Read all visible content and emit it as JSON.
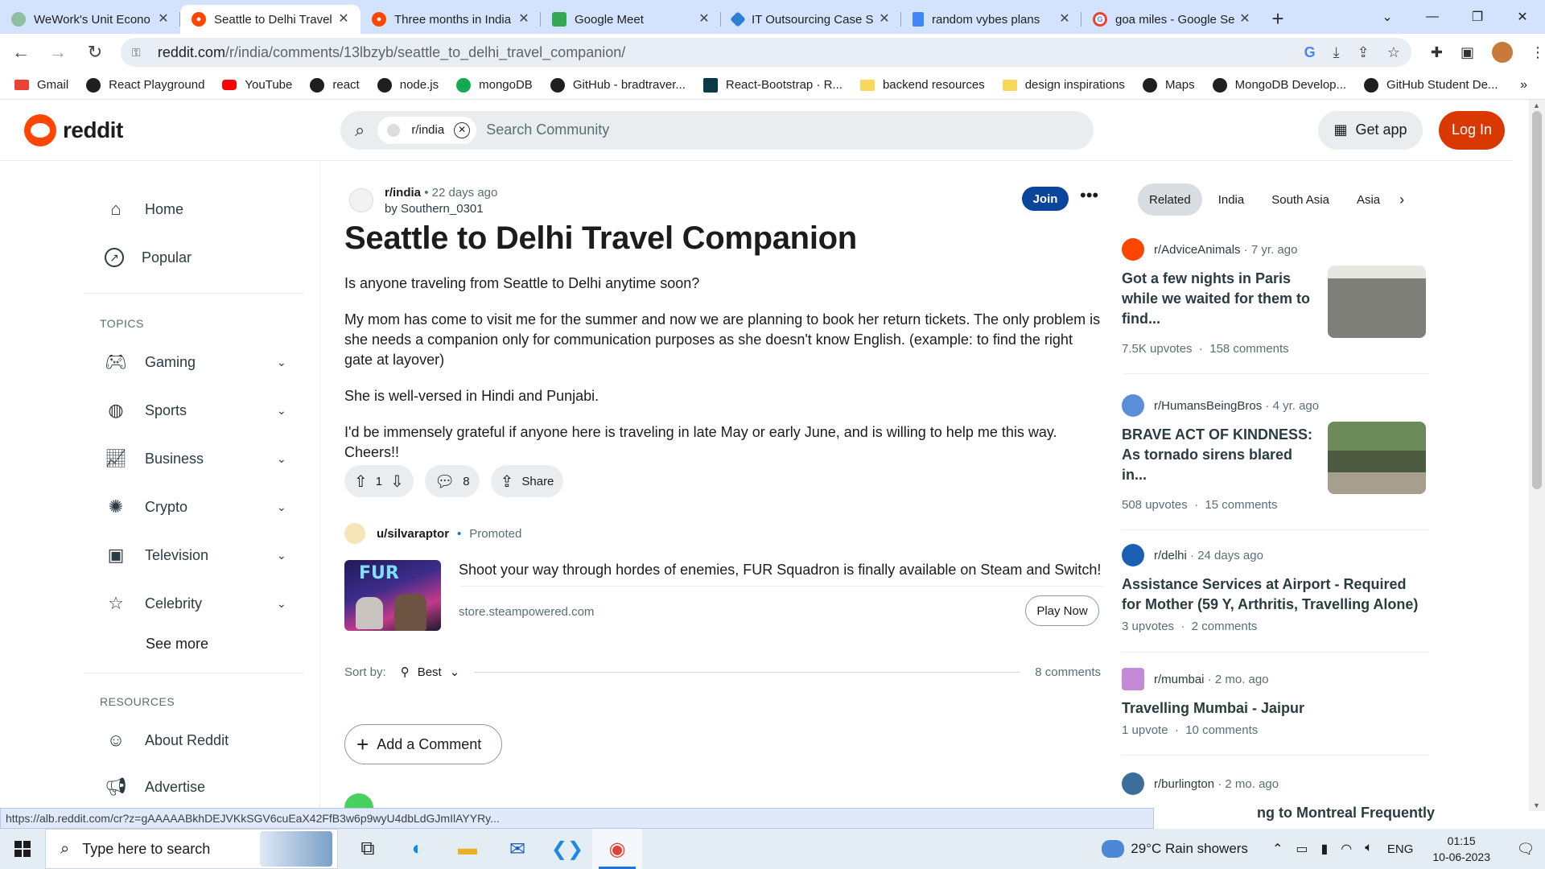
{
  "browser": {
    "tabs": [
      {
        "title": "WeWork's Unit Econo",
        "icon_color": "#8fbf9f",
        "active": false
      },
      {
        "title": "Seattle to Delhi Travel",
        "icon_color": "#ff4500",
        "active": true
      },
      {
        "title": "Three months in India",
        "icon_color": "#ff4500",
        "active": false
      },
      {
        "title": "Google Meet",
        "icon_color": "#34a853",
        "active": false
      },
      {
        "title": "IT Outsourcing Case S",
        "icon_color": "#2d7fd3",
        "active": false
      },
      {
        "title": "random vybes plans",
        "icon_color": "#4285f4",
        "active": false
      },
      {
        "title": "goa miles - Google Se",
        "icon_color": "#ea4335",
        "active": false
      }
    ],
    "url_host": "reddit.com",
    "url_path": "/r/india/comments/13lbzyb/seattle_to_delhi_travel_companion/",
    "bookmarks": [
      {
        "label": "Gmail",
        "icon_color": "#ea4335"
      },
      {
        "label": "React Playground",
        "icon_color": "#1f1f1f"
      },
      {
        "label": "YouTube",
        "icon_color": "#ff0000"
      },
      {
        "label": "react",
        "icon_color": "#1f1f1f"
      },
      {
        "label": "node.js",
        "icon_color": "#1f1f1f"
      },
      {
        "label": "mongoDB",
        "icon_color": "#13aa52"
      },
      {
        "label": "GitHub - bradtraver...",
        "icon_color": "#1f1f1f"
      },
      {
        "label": "React-Bootstrap · R...",
        "icon_color": "#0a3a4a"
      },
      {
        "label": "backend resources",
        "icon_color": "folder"
      },
      {
        "label": "design inspirations",
        "icon_color": "folder"
      },
      {
        "label": "Maps",
        "icon_color": "#1f1f1f"
      },
      {
        "label": "MongoDB Develop...",
        "icon_color": "#1f1f1f"
      },
      {
        "label": "GitHub Student De...",
        "icon_color": "#1f1f1f"
      }
    ],
    "bookmarks_more": "»",
    "status_url": "https://alb.reddit.com/cr?z=gAAAAABkhDEJVKkSGV6cuEaX42FfB3w6p9wyU4dbLdGJmIlAYYRy..."
  },
  "header": {
    "logo_text": "reddit",
    "search_chip": "r/india",
    "search_placeholder": "Search Community",
    "get_app": "Get app",
    "login": "Log In",
    "brand_color": "#ff4500"
  },
  "sidebar": {
    "nav": [
      {
        "label": "Home",
        "icon": "home-icon"
      },
      {
        "label": "Popular",
        "icon": "popular-icon"
      }
    ],
    "topics_label": "TOPICS",
    "topics": [
      {
        "label": "Gaming",
        "icon": "gamepad-icon"
      },
      {
        "label": "Sports",
        "icon": "ball-icon"
      },
      {
        "label": "Business",
        "icon": "chart-icon"
      },
      {
        "label": "Crypto",
        "icon": "crypto-icon"
      },
      {
        "label": "Television",
        "icon": "tv-icon"
      },
      {
        "label": "Celebrity",
        "icon": "star-icon"
      }
    ],
    "see_more": "See more",
    "resources_label": "RESOURCES",
    "resources": [
      {
        "label": "About Reddit",
        "icon": "reddit-icon"
      },
      {
        "label": "Advertise",
        "icon": "megaphone-icon"
      }
    ]
  },
  "post": {
    "subreddit": "r/india",
    "time": "22 days ago",
    "author": "by Southern_0301",
    "join": "Join",
    "title": "Seattle to Delhi Travel Companion",
    "paragraphs": [
      "Is anyone traveling from Seattle to Delhi anytime soon?",
      "My mom has come to visit me for the summer and now we are planning to book her return tickets. The only problem is she needs a companion only for communication purposes as she doesn't know English. (example: to find the right gate at layover)",
      "She is well-versed in Hindi and Punjabi.",
      "I'd be immensely grateful if anyone here is traveling in late May or early June, and is willing to help me this way. Cheers!!"
    ],
    "votes": "1",
    "comments_count": "8",
    "share": "Share"
  },
  "promo": {
    "user": "u/silvaraptor",
    "badge": "Promoted",
    "text": "Shoot your way through hordes of enemies, FUR Squadron is finally available on Steam and Switch!",
    "domain": "store.steampowered.com",
    "cta": "Play Now",
    "image_title": "FUR"
  },
  "comments": {
    "sort_label": "Sort by:",
    "sort_value": "Best",
    "count_label": "8 comments",
    "add_comment": "Add a Comment"
  },
  "related": {
    "tabs": [
      "Related",
      "India",
      "South Asia",
      "Asia"
    ],
    "cards": [
      {
        "sub": "r/AdviceAnimals",
        "age": "7 yr. ago",
        "title": "Got a few nights in Paris while we waited for them to find...",
        "upvotes": "7.5K upvotes",
        "comments": "158 comments",
        "icon_color": "#ff4500",
        "thumb_color": "#8b8f8a"
      },
      {
        "sub": "r/HumansBeingBros",
        "age": "4 yr. ago",
        "title": "BRAVE ACT OF KINDNESS: As tornado sirens blared in...",
        "upvotes": "508 upvotes",
        "comments": "15 comments",
        "icon_color": "#5a8fd8",
        "thumb_color": "#5f7a4d"
      },
      {
        "sub": "r/delhi",
        "age": "24 days ago",
        "title": "Assistance Services at Airport - Required for Mother (59 Y, Arthritis, Travelling Alone)",
        "upvotes": "3 upvotes",
        "comments": "2 comments",
        "icon_color": "#1b5fb5",
        "thumb_color": ""
      },
      {
        "sub": "r/mumbai",
        "age": "2 mo. ago",
        "title": "Travelling Mumbai - Jaipur",
        "upvotes": "1 upvote",
        "comments": "10 comments",
        "icon_color": "#c48ad8",
        "thumb_color": ""
      },
      {
        "sub": "r/burlington",
        "age": "2 mo. ago",
        "title": "ng to Montreal Frequently",
        "upvotes": "",
        "comments": "",
        "icon_color": "#3b6e9b",
        "thumb_color": ""
      }
    ]
  },
  "taskbar": {
    "search_placeholder": "Type here to search",
    "weather": "29°C  Rain showers",
    "lang": "ENG",
    "time": "01:15",
    "date": "10-06-2023"
  }
}
